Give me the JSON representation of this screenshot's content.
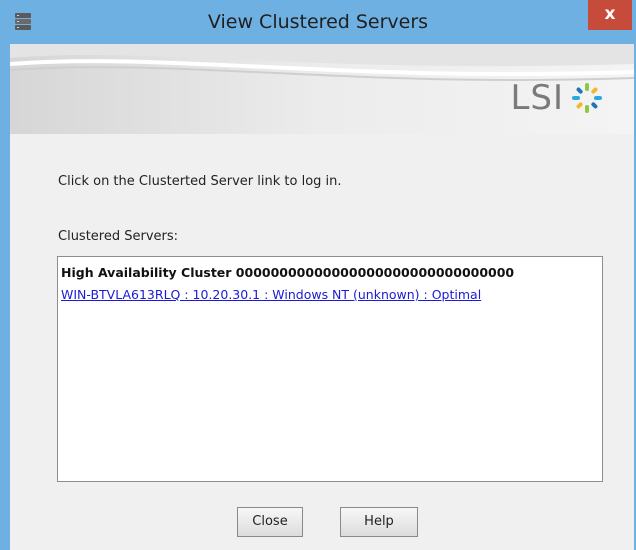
{
  "window": {
    "title": "View Clustered Servers",
    "close_glyph": "x",
    "app_icon": "database-server-icon",
    "close_color": "#c74b3b",
    "frame_color": "#6fb0e3"
  },
  "banner": {
    "logo_text": "LSI",
    "logo_icon": "lsi-star-icon"
  },
  "content": {
    "instructions": "Click on the Clusterted Server link to log in.",
    "list_label": "Clustered Servers:",
    "cluster_header": "High Availability Cluster 00000000000000000000000000000000",
    "server_link": "WIN-BTVLA613RLQ : 10.20.30.1 : Windows NT (unknown) : Optimal"
  },
  "buttons": {
    "close_label": "Close",
    "help_label": "Help"
  },
  "colors": {
    "link": "#1b1bd6",
    "dialog_bg": "#f0f0f0"
  }
}
